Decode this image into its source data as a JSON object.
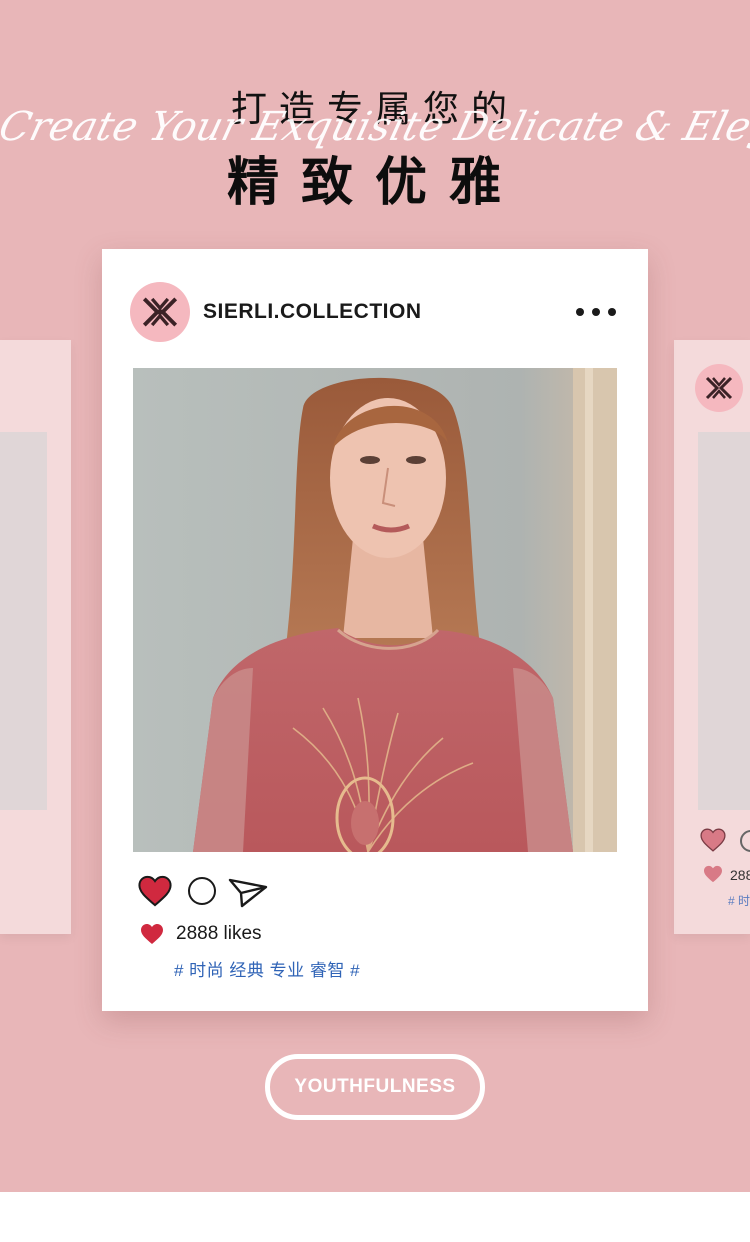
{
  "header": {
    "title_top": "打造专属您的",
    "script_line": "Create Your Exquisite Delicate & Elegance",
    "title_main": "精致优雅"
  },
  "post": {
    "account_name": "SIERLI.COLLECTION",
    "likes_text": "2888 likes",
    "hashtags": "# 时尚 经典 专业 睿智 #",
    "liked": true
  },
  "side_post": {
    "likes_text": "288",
    "hashtags": "# 时"
  },
  "icons": {
    "more": "more-dots-icon",
    "like": "heart-icon",
    "comment": "comment-circle-icon",
    "share": "send-icon"
  },
  "cta": {
    "label": "YOUTHFULNESS"
  },
  "colors": {
    "background": "#e8b6b8",
    "card": "#ffffff",
    "logo_bg": "#f5b8bf",
    "heart": "#d0293f",
    "hashtag": "#2f63b6"
  }
}
